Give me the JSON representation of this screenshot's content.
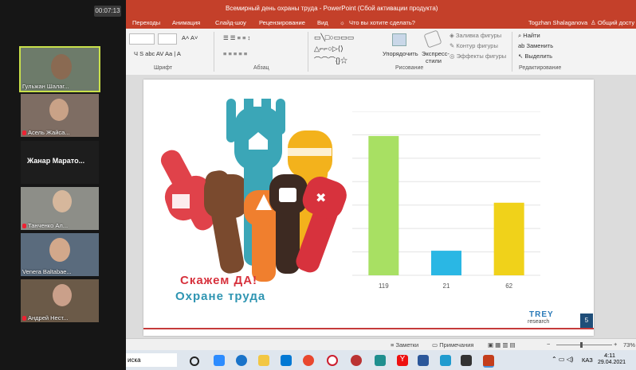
{
  "meeting": {
    "timer": "00:07:13",
    "participants": [
      {
        "name": "Гульжан Шалаг..."
      },
      {
        "name": "Асель Жайса..."
      },
      {
        "name": "Жанар  Марато..."
      },
      {
        "name": "Танченко Ал..."
      },
      {
        "name": "Venera Baltabae..."
      },
      {
        "name": "Андрей Нест..."
      }
    ]
  },
  "powerpoint": {
    "window_title": "Всемирный день охраны труда - PowerPoint (Сбой активации продукта)",
    "user": "Togzhan Shalaganova",
    "share": "Общий досту",
    "tabs": [
      "Переходы",
      "Анимация",
      "Слайд-шоу",
      "Рецензирование",
      "Вид"
    ],
    "tell_me": "Что вы хотите сделать?",
    "ribbon": {
      "font_group": "Шрифт",
      "paragraph_group": "Абзац",
      "drawing_group": "Рисование",
      "editing_group": "Редактирование",
      "arrange": "Упорядочить",
      "quick_styles": "Экспресс-стили",
      "shape_fill": "Заливка фигуры",
      "shape_outline": "Контур фигуры",
      "shape_effects": "Эффекты фигуры",
      "find": "Найти",
      "replace": "Заменить",
      "select": "Выделить"
    },
    "slide": {
      "slogan_line1": "Скажем ДА!",
      "slogan_line2": "Охране труда",
      "logo_top": "TREY",
      "logo_bottom": "research",
      "slide_number": "5"
    },
    "status": {
      "notes": "Заметки",
      "comments": "Примечания",
      "zoom": "73%"
    },
    "taskbar": {
      "search": "иска",
      "lang": "КАЗ",
      "time": "4:11",
      "date": "29.04.2021"
    }
  },
  "chart_data": {
    "type": "bar",
    "categories": [
      "119",
      "21",
      "62"
    ],
    "values": [
      119,
      21,
      62
    ],
    "colors": [
      "#a8e063",
      "#2ab7e4",
      "#f0d21a"
    ],
    "ylim": [
      0,
      140
    ],
    "grid": true
  }
}
